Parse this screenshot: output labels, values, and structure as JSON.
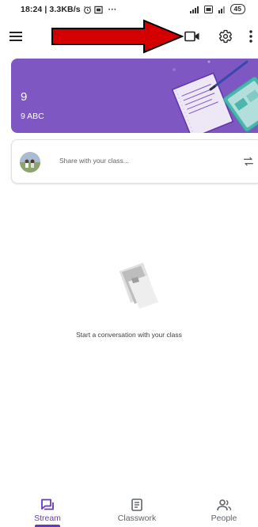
{
  "status_bar": {
    "time_speed": "18:24 | 3.3KB/s",
    "more_dots": "···",
    "battery": "45",
    "icons": [
      "alarm-icon",
      "notification-icon",
      "signal-icon",
      "volte-icon",
      "signal-icon",
      "battery-icon"
    ]
  },
  "app_bar": {
    "icons": [
      "menu-icon",
      "video-camera-icon",
      "settings-gear-icon",
      "more-vert-icon"
    ]
  },
  "annotation": {
    "arrow_color": "#d40000",
    "arrow_target": "video-camera-icon"
  },
  "class_banner": {
    "title": "9",
    "section": "9 ABC",
    "color": "#7e57c2"
  },
  "share": {
    "placeholder": "Share with your class...",
    "icons": [
      "avatar",
      "repost-icon"
    ]
  },
  "stream": {
    "empty_message": "Start a conversation with your class"
  },
  "bottom_nav": {
    "accent": "#673ab7",
    "active": "Stream",
    "items": [
      {
        "label": "Stream",
        "icon": "stream-icon"
      },
      {
        "label": "Classwork",
        "icon": "classwork-icon"
      },
      {
        "label": "People",
        "icon": "people-icon"
      }
    ]
  }
}
